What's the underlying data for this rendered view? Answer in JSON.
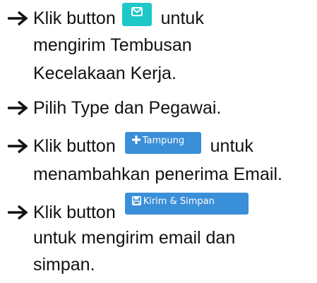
{
  "steps": [
    {
      "lines": [
        "Klik button",
        "untuk",
        "mengirim Tembusan",
        "Kecelakaan Kerja."
      ],
      "button": {
        "icon": "envelope-icon",
        "label": "",
        "color": "#1fc8c8"
      }
    },
    {
      "lines": [
        "Pilih Type dan Pegawai."
      ]
    },
    {
      "lines": [
        "Klik button",
        "untuk",
        "menambahkan penerima Email."
      ],
      "button": {
        "icon": "plus-icon",
        "label": "Tampung",
        "color": "#3a8fd9"
      }
    },
    {
      "lines": [
        "Klik button",
        "untuk mengirim email dan",
        "simpan."
      ],
      "button": {
        "icon": "save-icon",
        "label": "Kirim & Simpan",
        "color": "#3a8fd9"
      }
    }
  ],
  "bullet_icon": "right-arrow-icon",
  "colors": {
    "text": "#111111",
    "teal_button": "#1fc8c8",
    "blue_button": "#3a8fd9"
  }
}
